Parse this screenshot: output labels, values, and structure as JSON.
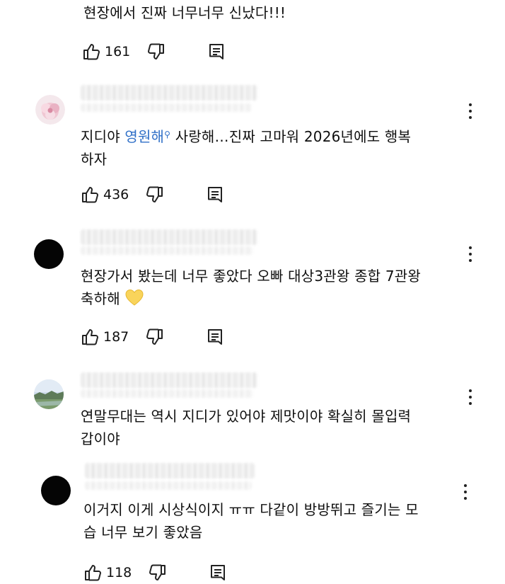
{
  "comments": [
    {
      "text": "현장에서 진짜 너무너무 신났다!!!",
      "likes": "161"
    },
    {
      "avatar": "flower-avatar",
      "text_before": "지디야 ",
      "mention": "영원해",
      "text_after": " 사랑해…진짜 고마워 2026년에도 행복",
      "text_line2": "하자",
      "likes": "436"
    },
    {
      "avatar": "black-avatar",
      "text_line1": "현장가서 봤는데 너무 좋았다 오빠 대상3관왕 종합 7관왕",
      "text_line2": "축하해",
      "emoji": "yellow-heart-icon",
      "likes": "187"
    },
    {
      "avatar": "landscape-avatar",
      "text_line1": "연말무대는 역시 지디가 있어야 제맛이야 확실히 몰입력",
      "text_line2": "갑이야"
    },
    {
      "avatar": "black-avatar",
      "text_line1": "이거지 이게 시상식이지 ㅠㅠ 다같이 방방뛰고 즐기는 모",
      "text_line2": "습 너무 보기 좋았음",
      "likes": "118"
    }
  ],
  "colors": {
    "text": "#0f0f0f",
    "mention": "#2f6fc7",
    "icon": "#222222"
  }
}
